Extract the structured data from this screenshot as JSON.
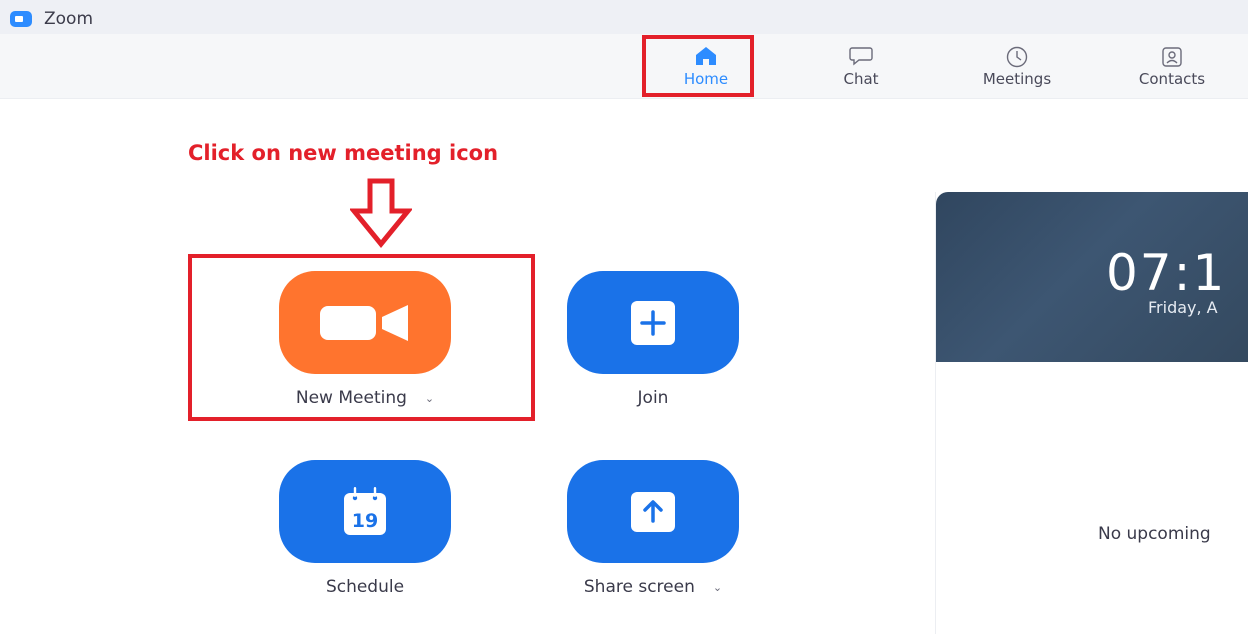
{
  "window": {
    "title": "Zoom",
    "icon": "zoom-camera-icon",
    "accent": "#2d8cff"
  },
  "nav": {
    "tabs": [
      {
        "label": "Home",
        "icon": "home-icon",
        "active": true
      },
      {
        "label": "Chat",
        "icon": "chat-bubble-icon",
        "active": false
      },
      {
        "label": "Meetings",
        "icon": "clock-icon",
        "active": false
      },
      {
        "label": "Contacts",
        "icon": "contact-card-icon",
        "active": false
      }
    ]
  },
  "annotation": {
    "text": "Click on new meeting icon",
    "color": "#e3202a",
    "arrow_icon": "down-arrow-icon"
  },
  "actions": [
    {
      "label": "New Meeting",
      "icon": "video-camera-icon",
      "color": "#ff742e",
      "has_dropdown": true
    },
    {
      "label": "Join",
      "icon": "plus-icon",
      "color": "#1a72e8",
      "has_dropdown": false
    },
    {
      "label": "Schedule",
      "icon": "calendar-icon",
      "icon_text": "19",
      "color": "#1a72e8",
      "has_dropdown": false
    },
    {
      "label": "Share screen",
      "icon": "upload-arrow-icon",
      "color": "#1a72e8",
      "has_dropdown": true
    }
  ],
  "clock_panel": {
    "time": "07:1",
    "date": "Friday, A",
    "no_upcoming": "No upcoming"
  }
}
